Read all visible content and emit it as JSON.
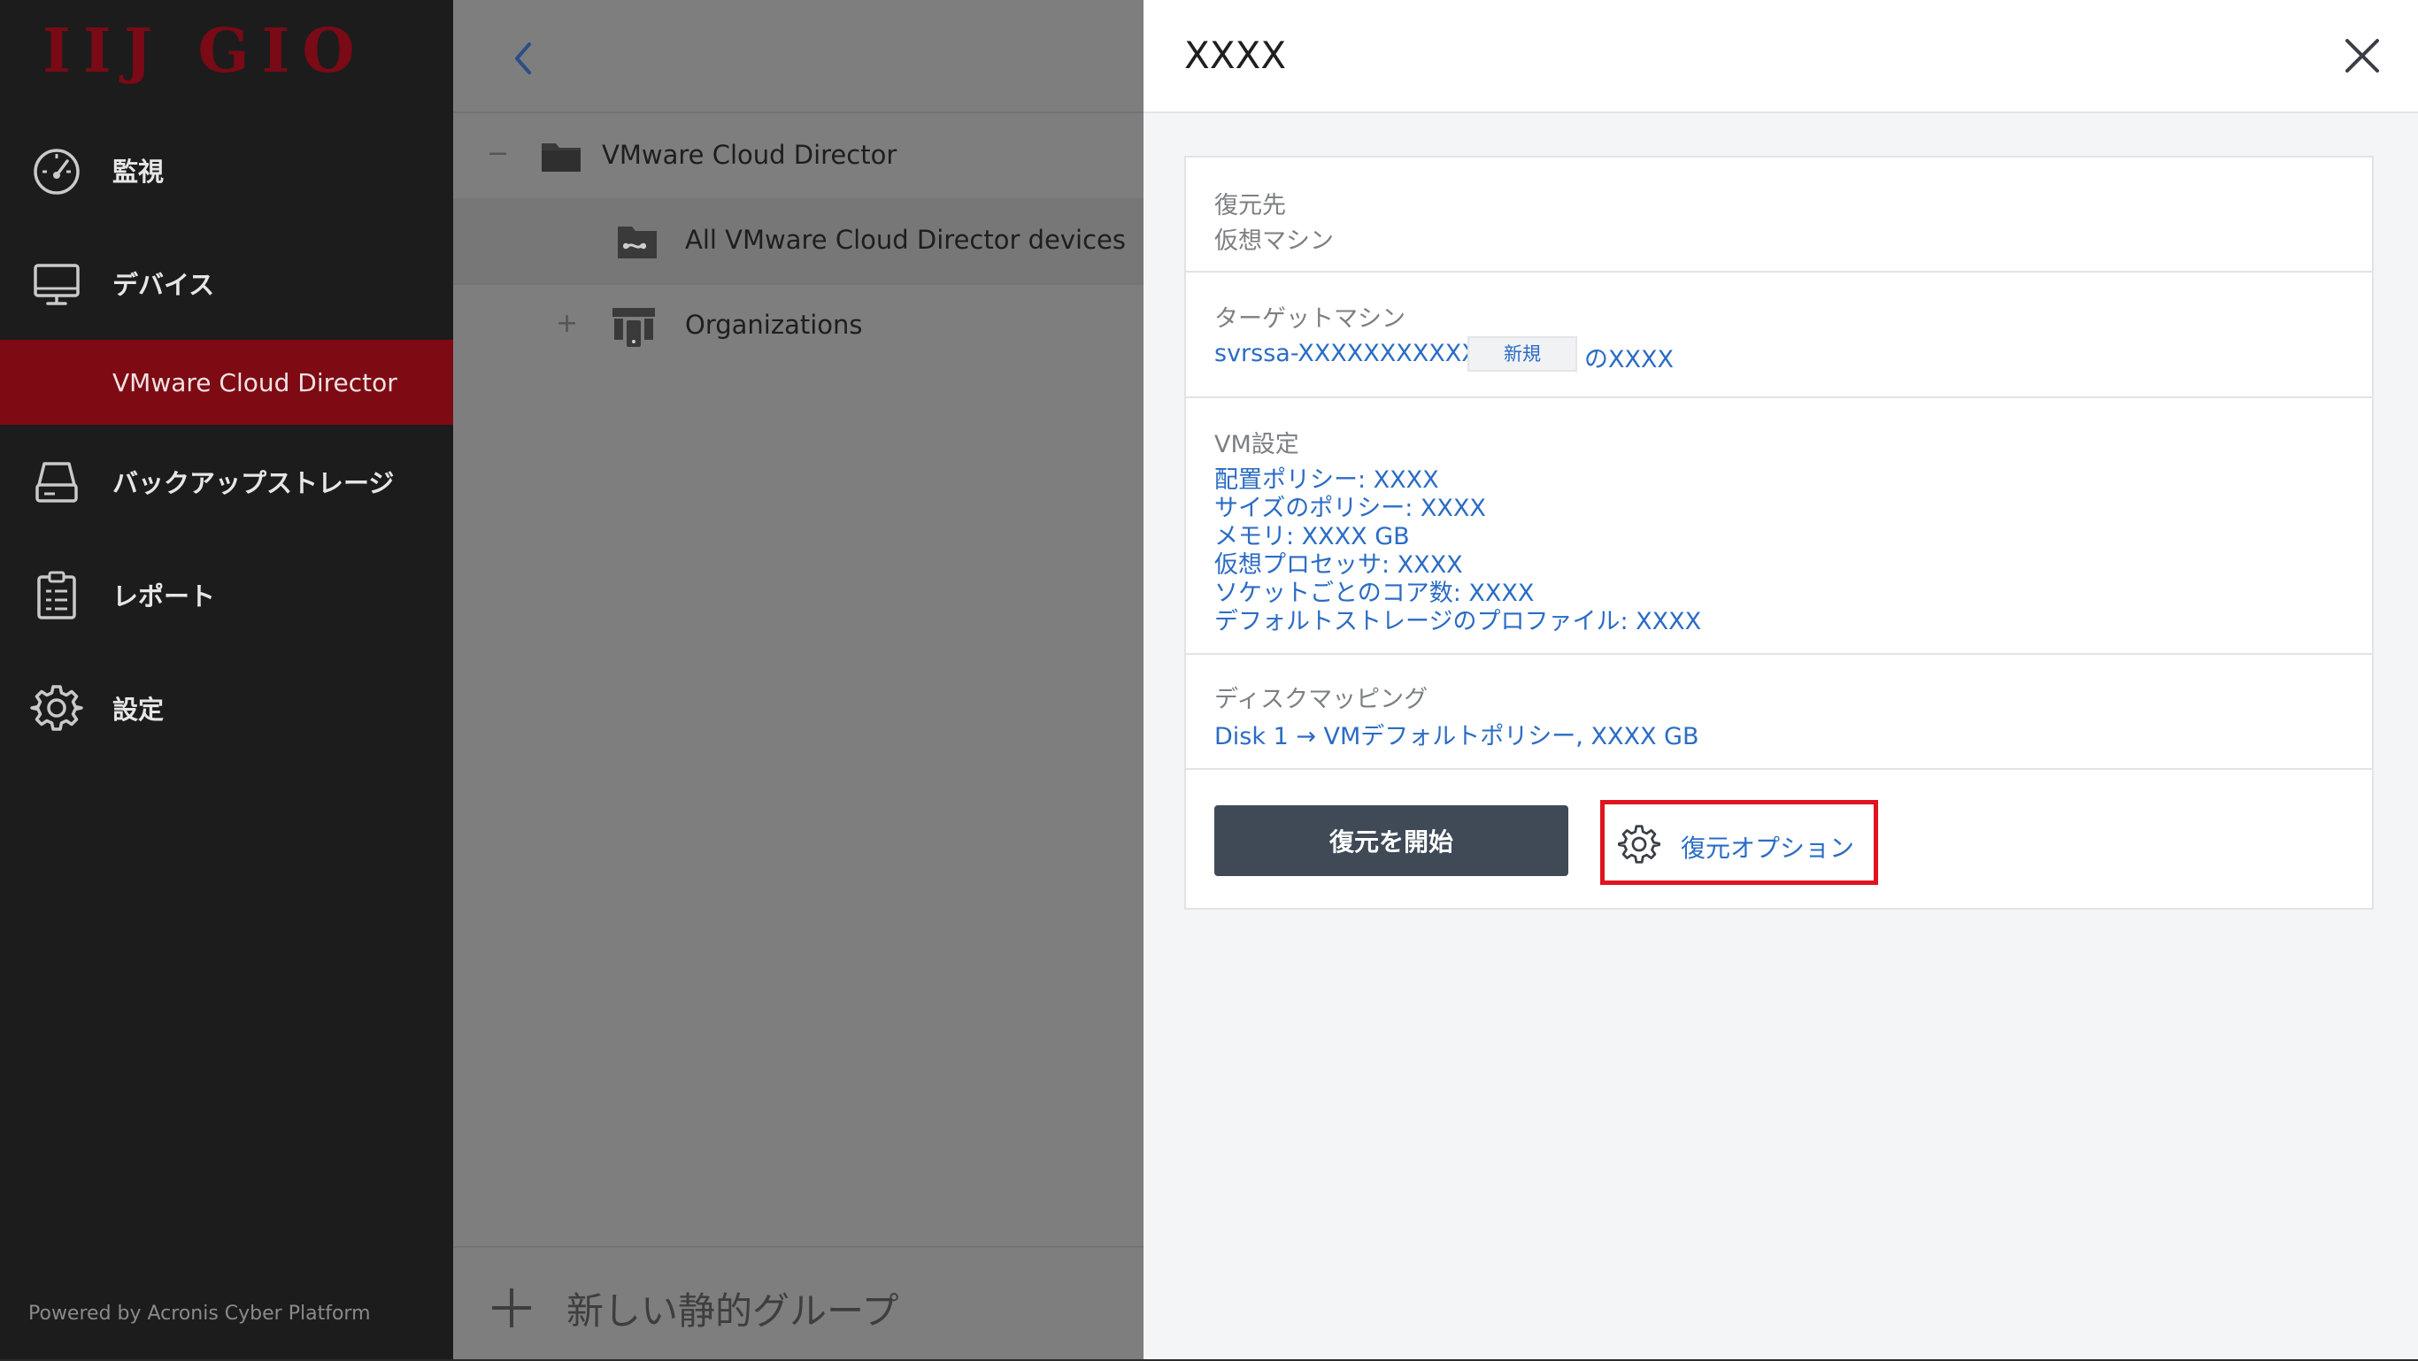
{
  "sidebar": {
    "logo": "IIJ GIO",
    "items": [
      {
        "label": "監視",
        "icon": "dashboard-gauge-icon"
      },
      {
        "label": "デバイス",
        "icon": "monitor-icon"
      },
      {
        "label": "バックアップストレージ",
        "icon": "storage-drive-icon"
      },
      {
        "label": "レポート",
        "icon": "clipboard-report-icon"
      },
      {
        "label": "設定",
        "icon": "gear-icon"
      }
    ],
    "sub_item": {
      "label": "VMware Cloud Director"
    },
    "powered_by": "Powered by Acronis Cyber Platform",
    "colors": {
      "background": "#1c1c1c",
      "active": "#7e0a14",
      "logo": "#7a0a16"
    }
  },
  "tree": {
    "rows": [
      {
        "toggle": "−",
        "label": "VMware Cloud Director",
        "icon": "folder-icon"
      },
      {
        "toggle": "",
        "label": "All VMware Cloud Director devices",
        "icon": "infinity-folder-icon"
      },
      {
        "toggle": "+",
        "label": "Organizations",
        "icon": "organizations-icon"
      }
    ],
    "add_group_label": "新しい静的グループ"
  },
  "panel": {
    "title": "XXXX",
    "restore_to": {
      "label": "復元先",
      "value": "仮想マシン"
    },
    "target_machine": {
      "label": "ターゲットマシン",
      "machine_name": "svrssa-XXXXXXXXXXXX",
      "badge": "新規",
      "suffix": "のXXXX"
    },
    "vm_settings": {
      "label": "VM設定",
      "lines": [
        "配置ポリシー: XXXX",
        "サイズのポリシー: XXXX",
        "メモリ: XXXX GB",
        "仮想プロセッサ: XXXX",
        "ソケットごとのコア数: XXXX",
        "デフォルトストレージのプロファイル: XXXX"
      ]
    },
    "disk_mapping": {
      "label": "ディスクマッピング",
      "value": "Disk 1 → VMデフォルトポリシー, XXXX GB"
    },
    "start_button": "復元を開始",
    "options_button": "復元オプション",
    "colors": {
      "link": "#2b6cc4",
      "button": "#3f4a56",
      "highlight": "#e0141e"
    }
  }
}
